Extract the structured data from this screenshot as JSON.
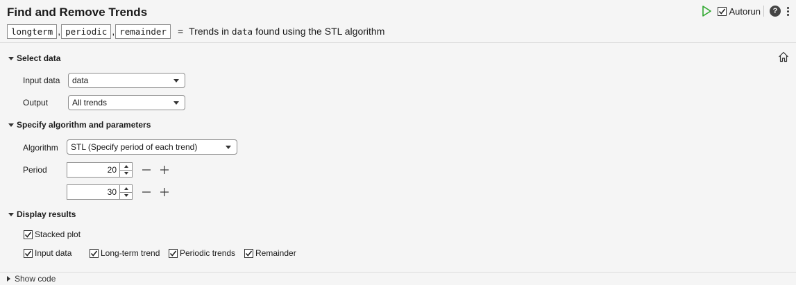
{
  "header": {
    "title": "Find and Remove Trends",
    "outputs": [
      "longterm",
      "periodic",
      "remainder"
    ],
    "equals": "=",
    "desc_before": "Trends in",
    "desc_var": "data",
    "desc_after": "found using the STL algorithm"
  },
  "toolbar": {
    "autorun_label": "Autorun",
    "autorun_checked": true,
    "help_label": "?"
  },
  "sections": {
    "select_data": {
      "title": "Select data",
      "input_label": "Input data",
      "input_value": "data",
      "output_label": "Output",
      "output_value": "All trends"
    },
    "algorithm": {
      "title": "Specify algorithm and parameters",
      "algorithm_label": "Algorithm",
      "algorithm_value": "STL (Specify period of each trend)",
      "period_label": "Period",
      "periods": [
        "20",
        "30"
      ]
    },
    "display": {
      "title": "Display results",
      "stacked_plot": "Stacked plot",
      "input_data": "Input data",
      "long_term": "Long-term trend",
      "periodic": "Periodic trends",
      "remainder": "Remainder"
    }
  },
  "footer": {
    "show_code": "Show code"
  },
  "colors": {
    "run_green": "#2fa82f",
    "background": "#f5f5f5"
  }
}
